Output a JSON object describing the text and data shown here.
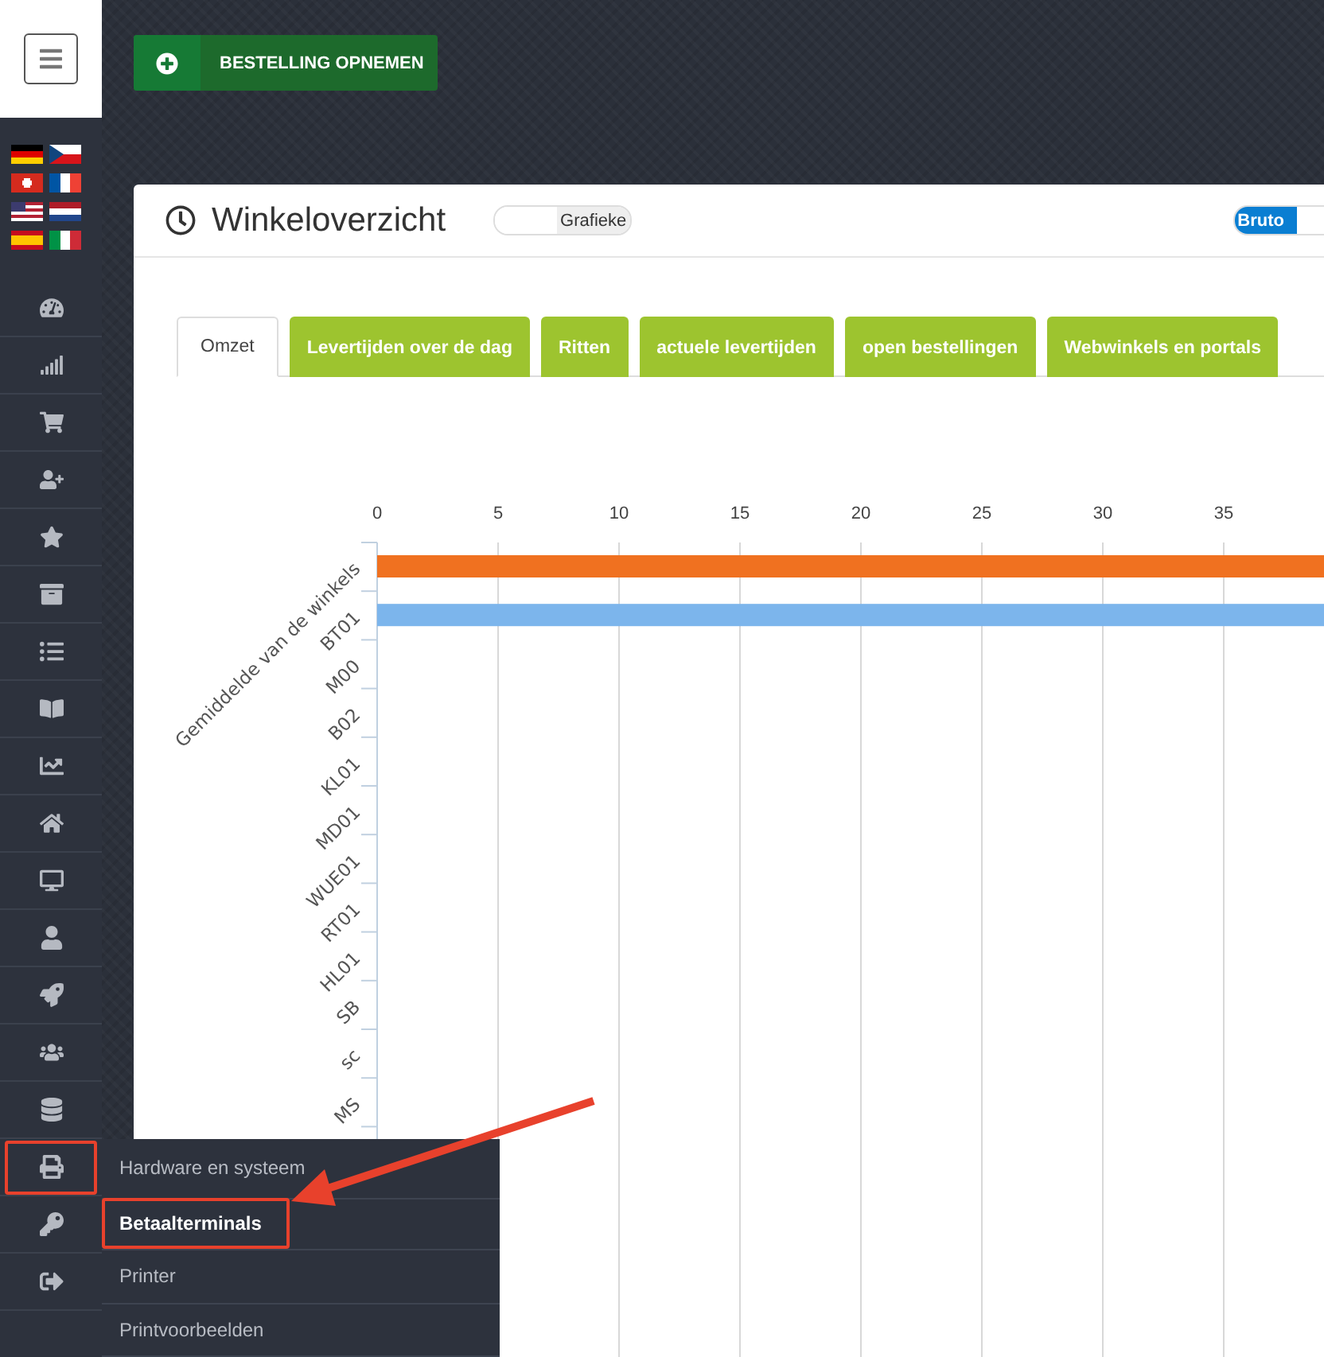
{
  "order_button": {
    "label": "BESTELLING OPNEMEN"
  },
  "sidebar": {
    "items": [
      {
        "highlighted": false
      },
      {
        "highlighted": false
      },
      {
        "highlighted": false
      },
      {
        "highlighted": false
      },
      {
        "highlighted": false
      },
      {
        "highlighted": false
      },
      {
        "highlighted": false
      },
      {
        "highlighted": false
      },
      {
        "highlighted": false
      },
      {
        "highlighted": false
      },
      {
        "highlighted": false
      },
      {
        "highlighted": false
      },
      {
        "highlighted": false
      },
      {
        "highlighted": false
      },
      {
        "highlighted": false
      },
      {
        "highlighted": true
      },
      {
        "highlighted": false
      },
      {
        "highlighted": false
      }
    ]
  },
  "card": {
    "title": "Winkeloverzicht",
    "view_toggle": {
      "label": "Grafieke",
      "on": false
    },
    "price_toggle": {
      "label": "Bruto",
      "on": true
    },
    "tabs": [
      {
        "label": "Omzet",
        "selected": true
      },
      {
        "label": "Levertijden over de dag",
        "selected": false
      },
      {
        "label": "Ritten",
        "selected": false
      },
      {
        "label": "actuele levertijden",
        "selected": false
      },
      {
        "label": "open bestellingen",
        "selected": false
      },
      {
        "label": "Webwinkels en portals",
        "selected": false
      }
    ],
    "chart": {
      "ticks": [
        "0",
        "5",
        "10",
        "15",
        "20",
        "25",
        "30",
        "35"
      ],
      "categories": [
        "Gemiddelde van de winkels",
        "BT01",
        "M00",
        "B02",
        "KL01",
        "MD01",
        "WUE01",
        "RT01",
        "HL01",
        "SB",
        "sc",
        "MS"
      ]
    }
  },
  "submenu": {
    "items": [
      {
        "label": "Hardware en systeem",
        "selected": false,
        "highlighted": false
      },
      {
        "label": "Betaalterminals",
        "selected": true,
        "highlighted": true
      },
      {
        "label": "Printer",
        "selected": false,
        "highlighted": false
      },
      {
        "label": "Printvoorbeelden",
        "selected": false,
        "highlighted": false
      }
    ]
  }
}
